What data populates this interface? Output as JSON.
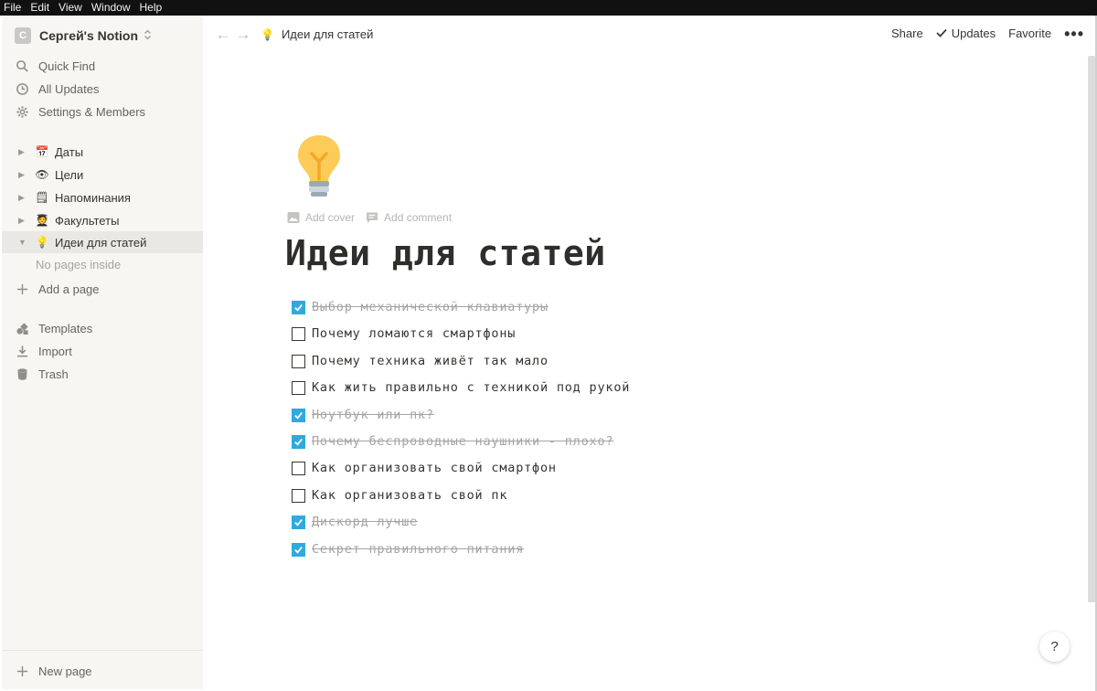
{
  "menubar": {
    "items": [
      "File",
      "Edit",
      "View",
      "Window",
      "Help"
    ]
  },
  "workspace": {
    "avatar_letter": "С",
    "name": "Сергей's Notion"
  },
  "sidebar": {
    "nav": [
      {
        "label": "Quick Find",
        "icon": "search-icon"
      },
      {
        "label": "All Updates",
        "icon": "clock-icon"
      },
      {
        "label": "Settings & Members",
        "icon": "gear-icon"
      }
    ],
    "pages": [
      {
        "emoji": "📅",
        "label": "Даты"
      },
      {
        "emoji": "👁",
        "label": "Цели"
      },
      {
        "emoji": "🗒",
        "label": "Напоминания"
      },
      {
        "emoji": "🧑‍🎓",
        "label": "Факультеты"
      },
      {
        "emoji": "💡",
        "label": "Идеи для статей"
      }
    ],
    "no_pages_text": "No pages inside",
    "add_page": "Add a page",
    "bottom_nav": [
      {
        "label": "Templates",
        "icon": "templates-icon"
      },
      {
        "label": "Import",
        "icon": "import-icon"
      },
      {
        "label": "Trash",
        "icon": "trash-icon"
      }
    ],
    "new_page": "New page"
  },
  "topbar": {
    "breadcrumb_emoji": "💡",
    "breadcrumb": "Идеи для статей",
    "share": "Share",
    "updates": "Updates",
    "favorite": "Favorite"
  },
  "page": {
    "icon": "lightbulb",
    "add_cover": "Add cover",
    "add_comment": "Add comment",
    "title": "Идеи для статей",
    "todos": [
      {
        "text": "Выбор механической клавиатуры",
        "checked": true
      },
      {
        "text": "Почему ломаются смартфоны",
        "checked": false
      },
      {
        "text": "Почему техника живёт так мало",
        "checked": false
      },
      {
        "text": "Как жить правильно с техникой под рукой",
        "checked": false
      },
      {
        "text": "Ноутбук или пк?",
        "checked": true
      },
      {
        "text": "Почему беспроводные наушники - плохо?",
        "checked": true
      },
      {
        "text": "Как организовать свой смартфон",
        "checked": false
      },
      {
        "text": "Как организовать свой пк",
        "checked": false
      },
      {
        "text": "Дискорд лучше",
        "checked": true
      },
      {
        "text": "Секрет правильного питания",
        "checked": true
      }
    ]
  },
  "help": {
    "label": "?"
  },
  "colors": {
    "accent": "#2eaadc",
    "sidebar_bg": "#f7f6f3",
    "text": "#37352f",
    "muted": "#a5a4a0"
  }
}
